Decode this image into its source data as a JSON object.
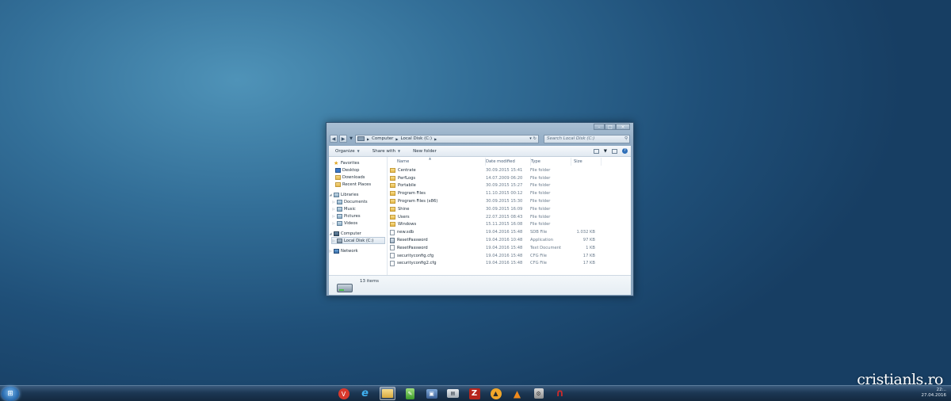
{
  "window": {
    "caption_buttons": [
      "–",
      "□",
      "×"
    ],
    "address": {
      "back_icon": "back-arrow-icon",
      "forward_icon": "forward-arrow-icon",
      "path": [
        "Computer",
        "Local Disk (C:)"
      ],
      "search_placeholder": "Search Local Disk (C:)"
    },
    "toolbar": {
      "organize": "Organize",
      "share_with": "Share with",
      "new_folder": "New folder"
    },
    "nav": {
      "favorites": {
        "label": "Favorites",
        "items": [
          "Desktop",
          "Downloads",
          "Recent Places"
        ]
      },
      "libraries": {
        "label": "Libraries",
        "items": [
          "Documents",
          "Music",
          "Pictures",
          "Videos"
        ]
      },
      "computer": {
        "label": "Computer",
        "items": [
          "Local Disk (C:)"
        ]
      },
      "network": {
        "label": "Network"
      }
    },
    "columns": {
      "name": "Name",
      "date": "Date modified",
      "type": "Type",
      "size": "Size"
    },
    "files": [
      {
        "name": "Centrate",
        "date": "30.09.2015 15:41",
        "type": "File folder",
        "size": "",
        "kind": "folder"
      },
      {
        "name": "PerfLogs",
        "date": "14.07.2009 06:20",
        "type": "File folder",
        "size": "",
        "kind": "folder"
      },
      {
        "name": "Portabile",
        "date": "30.09.2015 15:27",
        "type": "File folder",
        "size": "",
        "kind": "folder"
      },
      {
        "name": "Program Files",
        "date": "11.10.2015 00:12",
        "type": "File folder",
        "size": "",
        "kind": "folder"
      },
      {
        "name": "Program Files (x86)",
        "date": "30.09.2015 15:30",
        "type": "File folder",
        "size": "",
        "kind": "folder"
      },
      {
        "name": "Shine",
        "date": "30.09.2015 16:09",
        "type": "File folder",
        "size": "",
        "kind": "folder"
      },
      {
        "name": "Users",
        "date": "22.07.2015 08:43",
        "type": "File folder",
        "size": "",
        "kind": "folder"
      },
      {
        "name": "Windows",
        "date": "15.11.2015 16:08",
        "type": "File folder",
        "size": "",
        "kind": "folder"
      },
      {
        "name": "new.sdb",
        "date": "19.04.2016 15:48",
        "type": "SDB File",
        "size": "1.032 KB",
        "kind": "doc"
      },
      {
        "name": "ResetPassword",
        "date": "19.04.2016 10:48",
        "type": "Application",
        "size": "97 KB",
        "kind": "app"
      },
      {
        "name": "ResetPassword",
        "date": "19.04.2016 15:48",
        "type": "Text Document",
        "size": "1 KB",
        "kind": "doc"
      },
      {
        "name": "securityconfig.cfg",
        "date": "19.04.2016 15:48",
        "type": "CFG File",
        "size": "17 KB",
        "kind": "doc"
      },
      {
        "name": "securityconfig2.cfg",
        "date": "19.04.2016 15:48",
        "type": "CFG File",
        "size": "17 KB",
        "kind": "doc"
      }
    ],
    "status": {
      "count": "13 items"
    }
  },
  "taskbar": {
    "pinned": [
      "vivaldi-icon",
      "internet-explorer-icon",
      "explorer-icon",
      "notepad-icon",
      "remote-desktop-icon",
      "virtualbox-icon",
      "filezilla-icon",
      "aimp-icon",
      "vlc-icon",
      "tool-icon",
      "magnet-icon"
    ],
    "tray": {
      "time": "22:..",
      "date": "27.04.2016"
    }
  },
  "watermark": "cristianls.ro"
}
